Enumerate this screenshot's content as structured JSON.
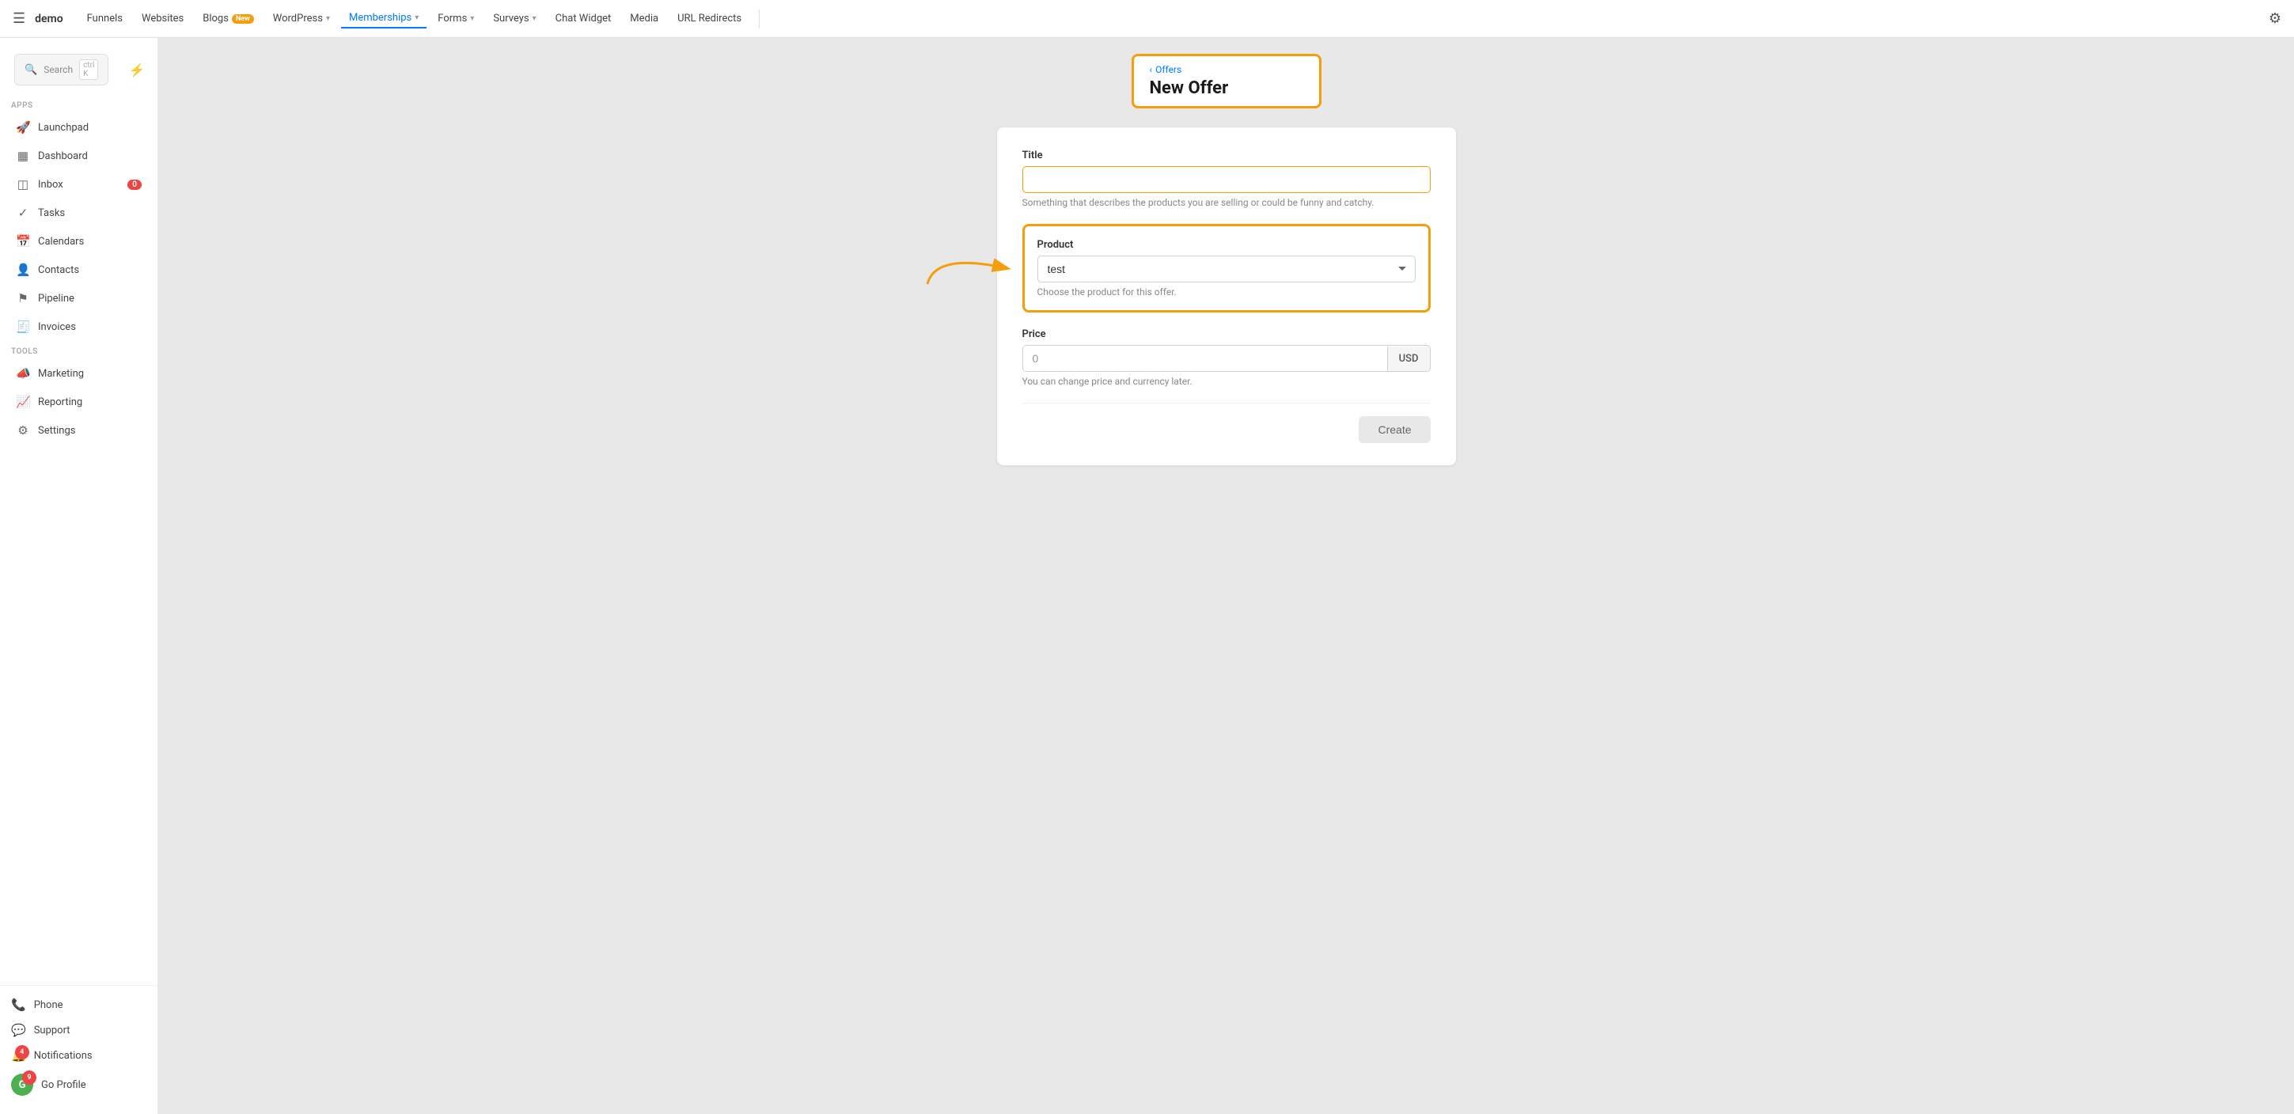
{
  "app": {
    "logo": "demo"
  },
  "topnav": {
    "items": [
      {
        "id": "funnels",
        "label": "Funnels",
        "hasChevron": false,
        "badge": null
      },
      {
        "id": "websites",
        "label": "Websites",
        "hasChevron": false,
        "badge": null
      },
      {
        "id": "blogs",
        "label": "Blogs",
        "hasChevron": false,
        "badge": "New"
      },
      {
        "id": "wordpress",
        "label": "WordPress",
        "hasChevron": true,
        "badge": null
      },
      {
        "id": "memberships",
        "label": "Memberships",
        "hasChevron": true,
        "badge": null,
        "active": true
      },
      {
        "id": "forms",
        "label": "Forms",
        "hasChevron": true,
        "badge": null
      },
      {
        "id": "surveys",
        "label": "Surveys",
        "hasChevron": true,
        "badge": null
      },
      {
        "id": "chat-widget",
        "label": "Chat Widget",
        "hasChevron": false,
        "badge": null
      },
      {
        "id": "media",
        "label": "Media",
        "hasChevron": false,
        "badge": null
      },
      {
        "id": "url-redirects",
        "label": "URL Redirects",
        "hasChevron": false,
        "badge": null
      }
    ]
  },
  "sidebar": {
    "search_label": "Search",
    "search_shortcut": "ctrl K",
    "apps_label": "Apps",
    "tools_label": "Tools",
    "items_apps": [
      {
        "id": "launchpad",
        "label": "Launchpad",
        "icon": "🚀"
      },
      {
        "id": "dashboard",
        "label": "Dashboard",
        "icon": "📊"
      },
      {
        "id": "inbox",
        "label": "Inbox",
        "icon": "📥",
        "badge": "0"
      },
      {
        "id": "tasks",
        "label": "Tasks",
        "icon": "✓"
      },
      {
        "id": "calendars",
        "label": "Calendars",
        "icon": "📅"
      },
      {
        "id": "contacts",
        "label": "Contacts",
        "icon": "👤"
      },
      {
        "id": "pipeline",
        "label": "Pipeline",
        "icon": "⚙"
      },
      {
        "id": "invoices",
        "label": "Invoices",
        "icon": "🧾"
      }
    ],
    "items_tools": [
      {
        "id": "marketing",
        "label": "Marketing",
        "icon": "📣"
      },
      {
        "id": "reporting",
        "label": "Reporting",
        "icon": "📈"
      },
      {
        "id": "settings",
        "label": "Settings",
        "icon": "⚙"
      }
    ],
    "bottom_items": [
      {
        "id": "phone",
        "label": "Phone",
        "icon": "📞"
      },
      {
        "id": "support",
        "label": "Support",
        "icon": "💬"
      },
      {
        "id": "notifications",
        "label": "Notifications",
        "icon": "🔔",
        "badge": "4"
      },
      {
        "id": "go-profile",
        "label": "Go Profile",
        "icon": "G",
        "badge": "9"
      }
    ]
  },
  "page": {
    "back_label": "Offers",
    "title": "New Offer"
  },
  "form": {
    "title_label": "Title",
    "title_placeholder": "",
    "title_hint": "Something that describes the products you are selling or could be funny and catchy.",
    "product_label": "Product",
    "product_value": "test",
    "product_hint": "Choose the product for this offer.",
    "price_label": "Price",
    "price_value": "0",
    "price_currency": "USD",
    "price_hint": "You can change price and currency later.",
    "create_button": "Create"
  }
}
